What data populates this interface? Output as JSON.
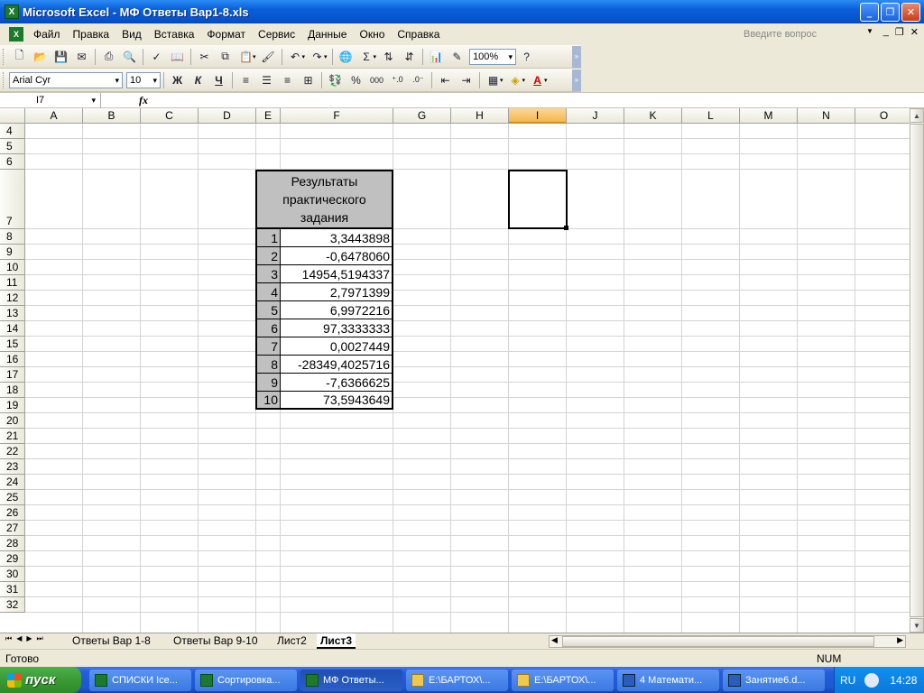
{
  "window": {
    "title": "Microsoft Excel - МФ Ответы Вар1-8.xls"
  },
  "menu": [
    "Файл",
    "Правка",
    "Вид",
    "Вставка",
    "Формат",
    "Сервис",
    "Данные",
    "Окно",
    "Справка"
  ],
  "ask": {
    "placeholder": "Введите вопрос"
  },
  "toolbar": {
    "zoom": "100%"
  },
  "format": {
    "font": "Arial Cyr",
    "size": "10",
    "bold": "Ж",
    "italic": "К",
    "underline": "Ч"
  },
  "namebox": "I7",
  "columns": [
    "A",
    "B",
    "C",
    "D",
    "E",
    "F",
    "G",
    "H",
    "I",
    "J",
    "K",
    "L",
    "M",
    "N",
    "O"
  ],
  "rows": [
    "4",
    "5",
    "6",
    "7",
    "8",
    "9",
    "10",
    "11",
    "12",
    "13",
    "14",
    "15",
    "16",
    "17",
    "18",
    "19",
    "20",
    "21",
    "22",
    "23",
    "24",
    "25",
    "26",
    "27",
    "28",
    "29",
    "30",
    "31",
    "32"
  ],
  "table": {
    "header": [
      "Результаты",
      "практического",
      "задания"
    ],
    "rows": [
      {
        "n": "1",
        "v": "3,3443898"
      },
      {
        "n": "2",
        "v": "-0,6478060"
      },
      {
        "n": "3",
        "v": "14954,5194337"
      },
      {
        "n": "4",
        "v": "2,7971399"
      },
      {
        "n": "5",
        "v": "6,9972216"
      },
      {
        "n": "6",
        "v": "97,3333333"
      },
      {
        "n": "7",
        "v": "0,0027449"
      },
      {
        "n": "8",
        "v": "-28349,4025716"
      },
      {
        "n": "9",
        "v": "-7,6366625"
      },
      {
        "n": "10",
        "v": "73,5943649"
      }
    ]
  },
  "tabs": [
    "Ответы Вар 1-8",
    "Ответы Вар 9-10",
    "Лист2",
    "Лист3"
  ],
  "status": {
    "ready": "Готово",
    "num": "NUM"
  },
  "taskbar": {
    "start": "пуск",
    "items": [
      "СПИСКИ Ice...",
      "Сортировка...",
      "МФ Ответы...",
      "E:\\БАРТОХ\\...",
      "E:\\БАРТОХ\\...",
      "4 Математи...",
      "Занятие6.d..."
    ],
    "lang": "RU",
    "clock": "14:28"
  }
}
